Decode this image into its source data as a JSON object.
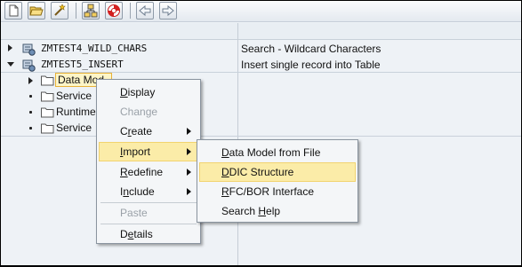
{
  "toolbar": {
    "buttons": [
      {
        "icon": "new-document-icon"
      },
      {
        "icon": "open-folder-icon"
      },
      {
        "icon": "wand-icon"
      },
      {
        "icon": "hierarchy-icon"
      },
      {
        "icon": "help-ring-icon"
      },
      {
        "icon": "back-arrow-icon"
      },
      {
        "icon": "forward-arrow-icon"
      }
    ]
  },
  "tree": {
    "projects": [
      {
        "name": "ZMTEST4_WILD_CHARS",
        "description": "Search - Wildcard Characters",
        "expanded": false
      },
      {
        "name": "ZMTEST5_INSERT",
        "description": "Insert single record into Table",
        "expanded": true
      }
    ],
    "children": [
      {
        "label": "Data Model",
        "shown": "Data Mod",
        "focused": true
      },
      {
        "label": "Service"
      },
      {
        "label": "Runtime"
      },
      {
        "label": "Service"
      }
    ]
  },
  "context_menu": {
    "items": [
      {
        "prefix": "",
        "key": "D",
        "rest": "isplay",
        "disabled": false,
        "submenu": false
      },
      {
        "prefix": "",
        "key": "C",
        "rest": "hange",
        "disabled": true,
        "submenu": false
      },
      {
        "prefix": "C",
        "key": "r",
        "rest": "eate",
        "disabled": false,
        "submenu": true
      },
      {
        "prefix": "",
        "key": "I",
        "rest": "mport",
        "disabled": false,
        "submenu": true,
        "hover": true
      },
      {
        "prefix": "",
        "key": "R",
        "rest": "edefine",
        "disabled": false,
        "submenu": true
      },
      {
        "prefix": "I",
        "key": "n",
        "rest": "clude",
        "disabled": false,
        "submenu": true
      },
      {
        "prefix": "",
        "key": "P",
        "rest": "aste",
        "disabled": true,
        "submenu": false
      },
      {
        "prefix": "D",
        "key": "e",
        "rest": "tails",
        "disabled": false,
        "submenu": false
      }
    ]
  },
  "import_submenu": {
    "items": [
      {
        "prefix": "",
        "key": "D",
        "rest": "ata Model from File"
      },
      {
        "prefix": "",
        "key": "D",
        "rest": "DIC Structure",
        "hover": true
      },
      {
        "prefix": "",
        "key": "R",
        "rest": "FC/BOR Interface"
      },
      {
        "prefix": "Search ",
        "key": "H",
        "rest": "elp"
      }
    ]
  },
  "colors": {
    "menu_hover": "#fbeca8",
    "focus_border": "#e8b23a",
    "panel_bg": "#eef2f6"
  }
}
